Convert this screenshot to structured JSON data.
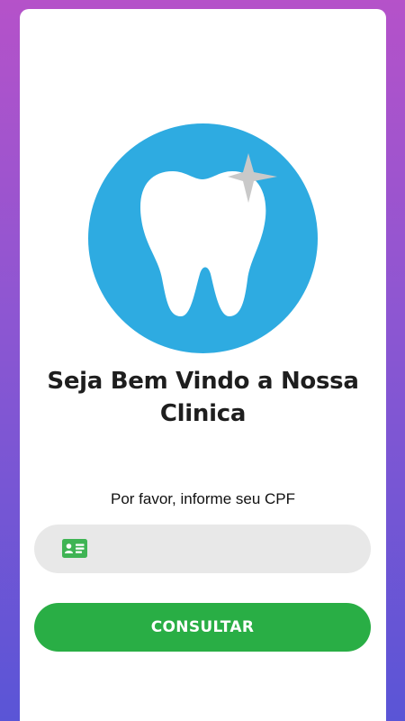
{
  "welcome": {
    "title": "Seja Bem Vindo a Nossa Clinica"
  },
  "form": {
    "prompt": "Por favor, informe seu CPF",
    "cpf_value": "",
    "cpf_placeholder": "",
    "cpf_icon": "id-card-icon",
    "submit_label": "CONSULTAR"
  },
  "logo": {
    "icon": "tooth-icon",
    "circle_color": "#2eabe1",
    "sparkle_color": "#c9c9c9"
  },
  "colors": {
    "primary": "#29ae45",
    "field_background": "#e8e8e8",
    "background_gradient_top": "#b552c9",
    "background_gradient_bottom": "#5a55d6"
  }
}
